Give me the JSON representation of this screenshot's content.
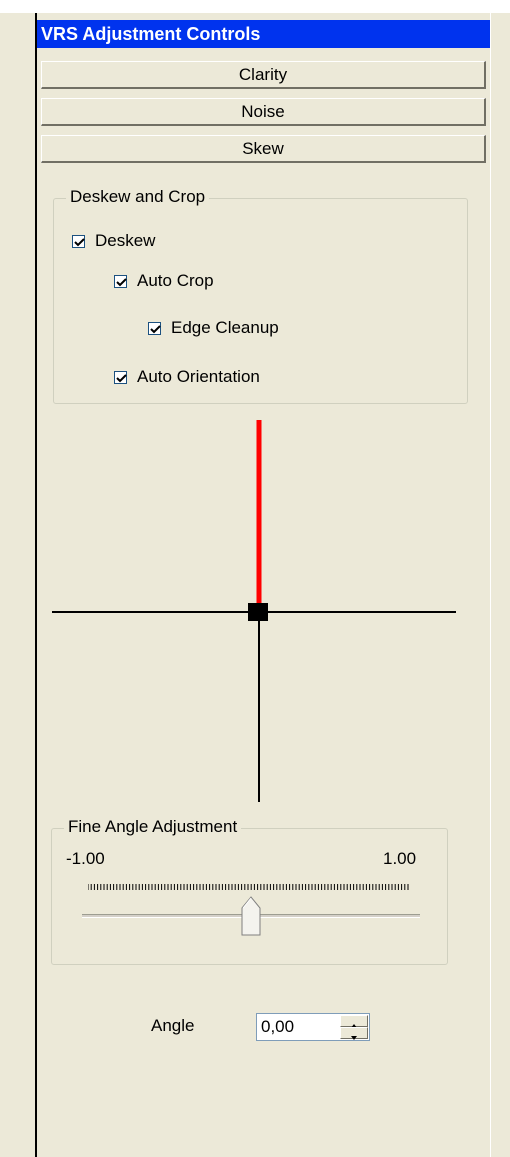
{
  "panel": {
    "title": "VRS Adjustment Controls"
  },
  "sections": [
    {
      "label": "Clarity"
    },
    {
      "label": "Noise"
    },
    {
      "label": "Skew"
    }
  ],
  "deskew_group": {
    "title": "Deskew and Crop",
    "options": [
      {
        "label": "Deskew",
        "checked": true
      },
      {
        "label": "Auto Crop",
        "checked": true
      },
      {
        "label": "Edge Cleanup",
        "checked": true
      },
      {
        "label": "Auto Orientation",
        "checked": true
      }
    ]
  },
  "angle_indicator": {
    "indicator_color": "#ff0000"
  },
  "fine_angle": {
    "title": "Fine Angle Adjustment",
    "min_label": "-1.00",
    "max_label": "1.00",
    "slider_fraction": 0.5
  },
  "angle": {
    "label": "Angle",
    "value": "0,00"
  },
  "colors": {
    "title_bar": "#0033ee",
    "background": "#ece9d8"
  }
}
